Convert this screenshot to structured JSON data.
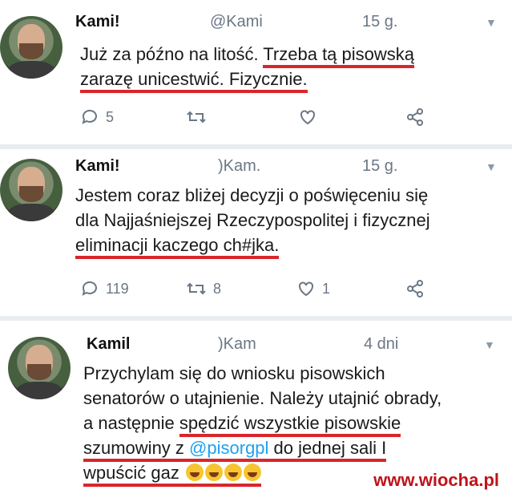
{
  "tweets": [
    {
      "name": "Kami!",
      "handle": "@Kami",
      "time": "15 g.",
      "text_plain": "Już za późno na litość.",
      "text_hl1": "Trzeba tą pisowską",
      "text_hl2": "zarazę unicestwić. Fizycznie.",
      "replies": "5",
      "retweets": "",
      "likes": ""
    },
    {
      "name": "Kami!",
      "handle": ")Kam.",
      "time": "15 g.",
      "line1": "Jestem coraz bliżej decyzji o poświęceniu się",
      "line2": "dla Najjaśniejszej Rzeczypospolitej i fizycznej",
      "line3_hl": "eliminacji kaczego ch#jka.",
      "replies": "119",
      "retweets": "8",
      "likes": "1"
    },
    {
      "name": "Kamil",
      "handle": ")Kam",
      "time": "4 dni",
      "line1": "Przychylam się do wniosku pisowskich",
      "line2": "senatorów o utajnienie. Należy utajnić obrady,",
      "line3_plain": "a następnie ",
      "line3_hl": "spędzić wszystkie pisowskie",
      "line4_hl_a": "szumowiny z ",
      "line4_mention": "@pisorgpl",
      "line4_hl_b": " do jednej sali I",
      "line5_hl": "wpuścić gaz"
    }
  ],
  "watermark": "www.wiocha.pl",
  "colors": {
    "underline": "#d8262c",
    "meta": "#6b7785",
    "separator": "#e9ecef",
    "mention": "#1da1f2"
  }
}
